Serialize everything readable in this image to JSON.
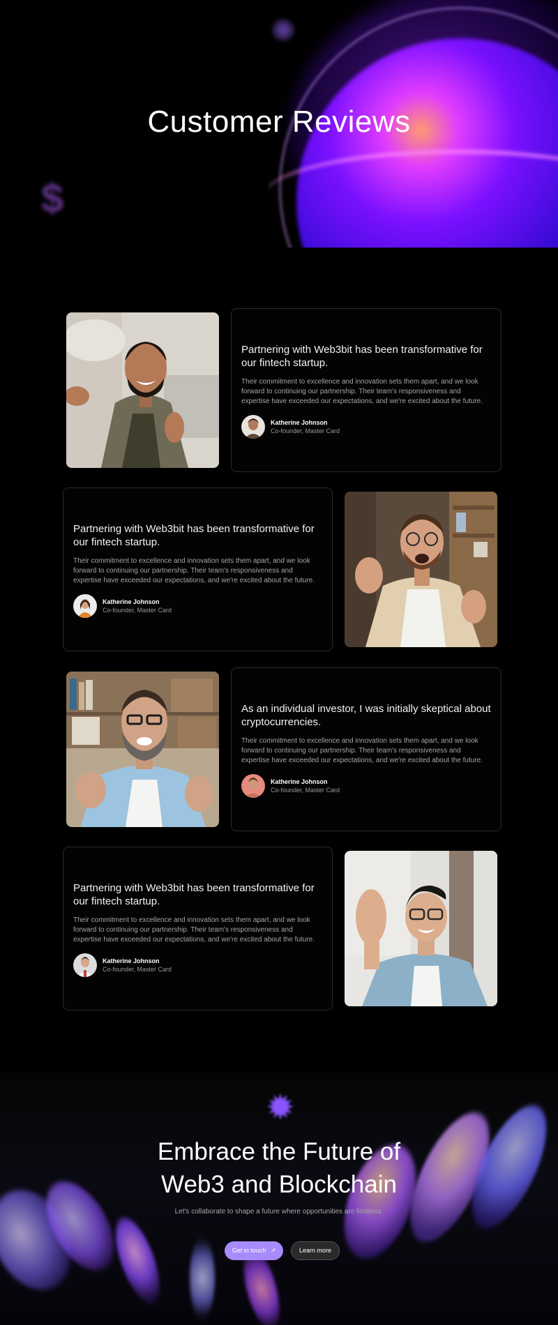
{
  "hero": {
    "title": "Customer Reviews",
    "decorations": [
      "gear-icon",
      "dollar-icon",
      "purple-orb"
    ]
  },
  "reviews": [
    {
      "title": "Partnering with Web3bit has been transformative for our fintech startup.",
      "body": "Their commitment to excellence and innovation sets them apart, and we look forward to continuing our partnership. Their team's responsiveness and expertise have exceeded our expectations, and we're excited about the future.",
      "author": "Katherine Johnson",
      "role": "Co-founder, Master Card",
      "photo_alt": "Smiling bearded man giving thumbs up",
      "photo_side": "left"
    },
    {
      "title": "Partnering with Web3bit has been transformative for our fintech startup.",
      "body": "Their commitment to excellence and innovation sets them apart, and we look forward to continuing our partnership. Their team's responsiveness and expertise have exceeded our expectations, and we're excited about the future.",
      "author": "Katherine Johnson",
      "role": "Co-founder, Master Card",
      "photo_alt": "Excited man with glasses gesturing",
      "photo_side": "right"
    },
    {
      "title": "As an individual investor, I was initially skeptical about cryptocurrencies.",
      "body": "Their commitment to excellence and innovation sets them apart, and we look forward to continuing our partnership. Their team's responsiveness and expertise have exceeded our expectations, and we're excited about the future.",
      "author": "Katherine Johnson",
      "role": "Co-founder, Master Card",
      "photo_alt": "Bearded man with glasses in front of bookshelf",
      "photo_side": "left"
    },
    {
      "title": "Partnering with Web3bit has been transformative for our fintech startup.",
      "body": "Their commitment to excellence and innovation sets them apart, and we look forward to continuing our partnership. Their team's responsiveness and expertise have exceeded our expectations, and we're excited about the future.",
      "author": "Katherine Johnson",
      "role": "Co-founder, Master Card",
      "photo_alt": "Smiling man with glasses waving",
      "photo_side": "right"
    }
  ],
  "cta": {
    "title_line1": "Embrace the Future of",
    "title_line2": "Web3 and Blockchain",
    "subtitle": "Let's collaborate to shape a future where opportunities are limitless.",
    "primary_button": "Get in touch",
    "primary_icon": "↗",
    "secondary_button": "Learn more"
  },
  "colors": {
    "background": "#000000",
    "accent": "#a78bfa",
    "orb": "#3a0bd6",
    "card_border": "#2a2a2a"
  }
}
